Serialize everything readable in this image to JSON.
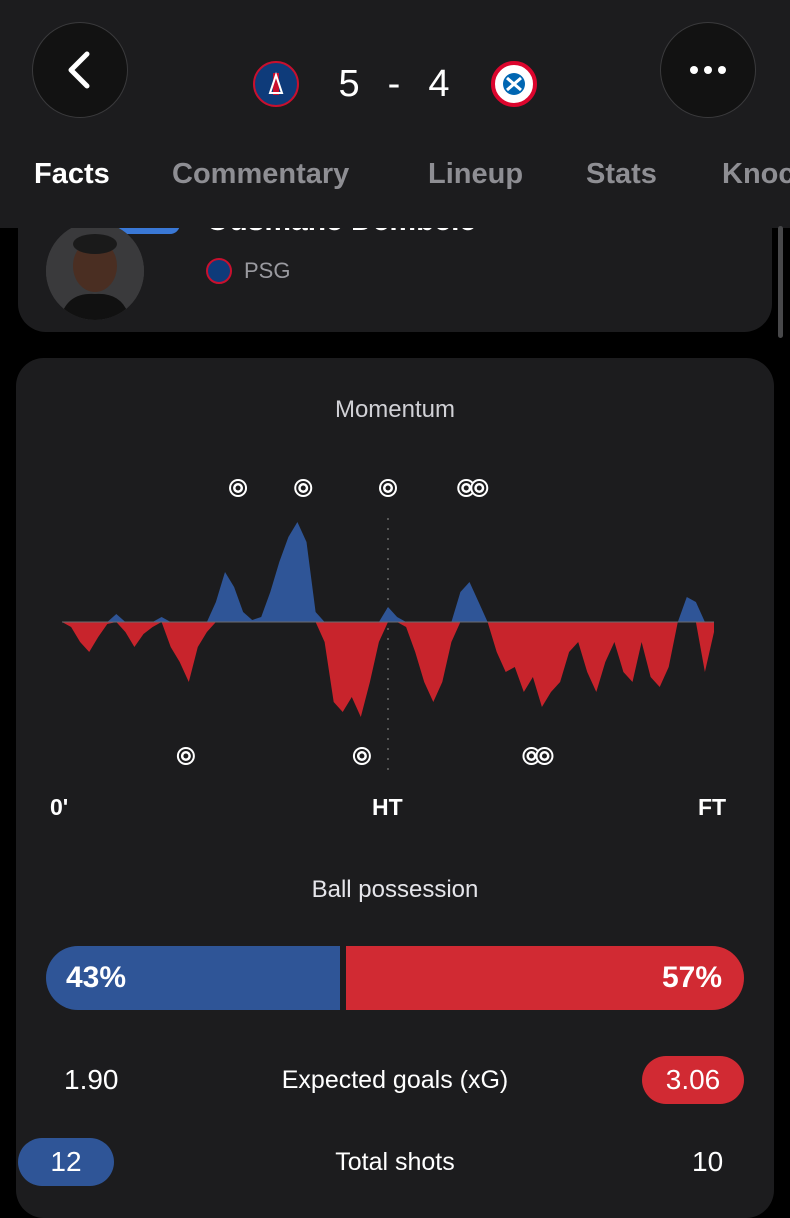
{
  "match": {
    "home_score": "5",
    "separator": "-",
    "away_score": "4",
    "home_team": "PSG",
    "away_team": "Bayern München"
  },
  "tabs": [
    "Facts",
    "Commentary",
    "Lineup",
    "Stats",
    "Knoc"
  ],
  "player": {
    "name": "Ousmane Dembélé",
    "team": "PSG"
  },
  "momentum": {
    "title": "Momentum",
    "start_label": "0'",
    "half_label": "HT",
    "end_label": "FT",
    "home_color": "#2f5597",
    "away_color": "#c8242c",
    "home_goal_positions": [
      0.27,
      0.37,
      0.5,
      0.62,
      0.64
    ],
    "away_goal_positions": [
      0.19,
      0.46,
      0.72,
      0.74
    ],
    "series": [
      0.0,
      -0.05,
      -0.2,
      -0.3,
      -0.15,
      -0.02,
      0.08,
      -0.1,
      -0.25,
      -0.12,
      -0.05,
      0.05,
      -0.25,
      -0.4,
      -0.6,
      -0.25,
      -0.1,
      0.2,
      0.5,
      0.35,
      0.1,
      0.02,
      0.05,
      0.3,
      0.6,
      0.85,
      1.0,
      0.8,
      0.1,
      -0.2,
      -0.8,
      -0.9,
      -0.75,
      -0.95,
      -0.6,
      -0.2,
      0.15,
      0.05,
      -0.05,
      -0.3,
      -0.6,
      -0.8,
      -0.6,
      -0.2,
      0.3,
      0.4,
      0.2,
      0.0,
      -0.3,
      -0.5,
      -0.45,
      -0.7,
      -0.55,
      -0.85,
      -0.7,
      -0.6,
      -0.3,
      -0.2,
      -0.5,
      -0.7,
      -0.4,
      -0.2,
      -0.5,
      -0.6,
      -0.2,
      -0.55,
      -0.65,
      -0.45,
      0.0,
      0.25,
      0.2,
      -0.5,
      -0.1
    ]
  },
  "possession": {
    "title": "Ball possession",
    "home_pct": 43,
    "home_label": "43%",
    "away_label": "57%"
  },
  "stats": [
    {
      "label": "Expected goals (xG)",
      "home": "1.90",
      "away": "3.06",
      "highlight": "away"
    },
    {
      "label": "Total shots",
      "home": "12",
      "away": "10",
      "highlight": "home"
    }
  ],
  "colors": {
    "home": "#2f5597",
    "away": "#d12a33",
    "card": "#1c1c1e"
  }
}
